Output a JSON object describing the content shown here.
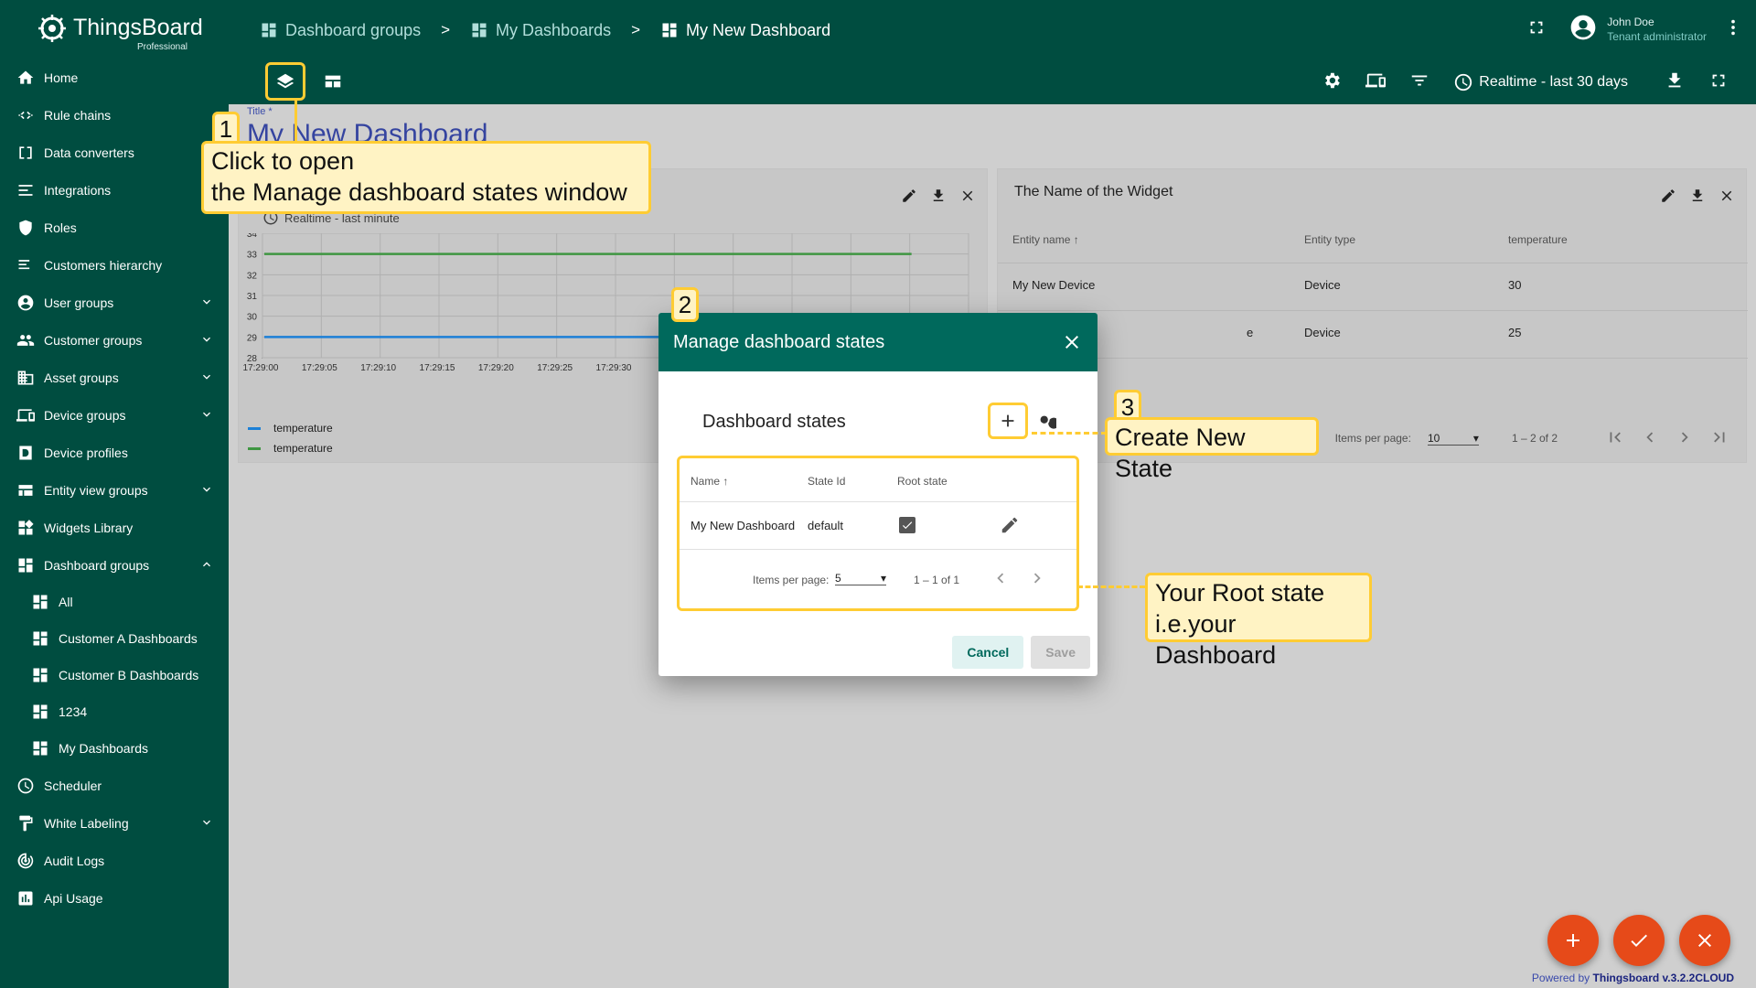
{
  "app": {
    "logo_text": "ThingsBoard",
    "logo_sub": "Professional"
  },
  "sidebar": {
    "items": [
      {
        "label": "Home",
        "icon": "home-icon",
        "chevron": ""
      },
      {
        "label": "Rule chains",
        "icon": "rule-chains-icon",
        "chevron": ""
      },
      {
        "label": "Data converters",
        "icon": "converter-icon",
        "chevron": ""
      },
      {
        "label": "Integrations",
        "icon": "integration-icon",
        "chevron": ""
      },
      {
        "label": "Roles",
        "icon": "shield-icon",
        "chevron": ""
      },
      {
        "label": "Customers hierarchy",
        "icon": "hierarchy-icon",
        "chevron": ""
      },
      {
        "label": "User groups",
        "icon": "account-icon",
        "chevron": "down"
      },
      {
        "label": "Customer groups",
        "icon": "group-icon",
        "chevron": "down"
      },
      {
        "label": "Asset groups",
        "icon": "domain-icon",
        "chevron": "down"
      },
      {
        "label": "Device groups",
        "icon": "devices-icon",
        "chevron": "down"
      },
      {
        "label": "Device profiles",
        "icon": "device-profile-icon",
        "chevron": ""
      },
      {
        "label": "Entity view groups",
        "icon": "view-quilt-icon",
        "chevron": "down"
      },
      {
        "label": "Widgets Library",
        "icon": "widgets-icon",
        "chevron": ""
      },
      {
        "label": "Dashboard groups",
        "icon": "dashboard-icon",
        "chevron": "up"
      }
    ],
    "sub_items": [
      {
        "label": "All"
      },
      {
        "label": "Customer A Dashboards"
      },
      {
        "label": "Customer B Dashboards"
      },
      {
        "label": "1234"
      },
      {
        "label": "My Dashboards"
      }
    ],
    "items_after": [
      {
        "label": "Scheduler",
        "icon": "schedule-icon",
        "chevron": ""
      },
      {
        "label": "White Labeling",
        "icon": "format-paint-icon",
        "chevron": "down"
      },
      {
        "label": "Audit Logs",
        "icon": "track-changes-icon",
        "chevron": ""
      },
      {
        "label": "Api Usage",
        "icon": "insert-chart-icon",
        "chevron": ""
      }
    ]
  },
  "breadcrumb": {
    "items": [
      "Dashboard groups",
      "My Dashboards",
      "My New Dashboard"
    ],
    "separator": ">"
  },
  "user": {
    "name": "John Doe",
    "role": "Tenant administrator"
  },
  "toolbar": {
    "timewindow": "Realtime - last 30 days"
  },
  "dashboard": {
    "title_label": "Title *",
    "title": "My New Dashboard"
  },
  "widget_chart": {
    "realtime": "Realtime - last minute",
    "legend": [
      {
        "name": "temperature",
        "color": "#1e88e5"
      },
      {
        "name": "temperature",
        "color": "#43a047"
      }
    ]
  },
  "chart_data": {
    "type": "line",
    "x": [
      "17:29:00",
      "17:29:05",
      "17:29:10",
      "17:29:15",
      "17:29:20",
      "17:29:25",
      "17:29:30",
      "17:29:35",
      "17:29:40",
      "17:29:45",
      "17:29:50",
      "17:29:55",
      "17:30:00"
    ],
    "x_tick_labels": [
      "17:29:00",
      "17:29:05",
      "17:29:10",
      "17:29:15",
      "17:29:20",
      "17:29:25",
      "17:29:30"
    ],
    "y_ticks": [
      28,
      29,
      30,
      31,
      32,
      33,
      34
    ],
    "ylim": [
      28,
      34
    ],
    "series": [
      {
        "name": "temperature",
        "color": "#1e88e5",
        "values": [
          29,
          29,
          29,
          29,
          29,
          29,
          29,
          29,
          29,
          29,
          29,
          29
        ]
      },
      {
        "name": "temperature",
        "color": "#43a047",
        "values": [
          33,
          33,
          33,
          33,
          33,
          33,
          33,
          33,
          33,
          33,
          33,
          33
        ]
      }
    ],
    "grid": true
  },
  "widget_table": {
    "title": "The Name of the Widget",
    "columns": [
      "Entity name",
      "Entity type",
      "temperature"
    ],
    "rows": [
      [
        "My New Device",
        "Device",
        "30"
      ],
      [
        "",
        "Device",
        "25"
      ]
    ],
    "row2_name_tail": "e",
    "items_per_page_label": "Items per page:",
    "items_per_page": "10",
    "range": "1 – 2 of 2"
  },
  "dialog": {
    "title": "Manage dashboard states",
    "subtitle": "Dashboard states",
    "columns": [
      "Name",
      "State Id",
      "Root state"
    ],
    "rows": [
      {
        "name": "My New Dashboard",
        "state_id": "default",
        "root": true
      }
    ],
    "items_per_page_label": "Items per page:",
    "items_per_page": "5",
    "range": "1 – 1 of 1",
    "cancel": "Cancel",
    "save": "Save"
  },
  "callouts": {
    "n1": "1",
    "c1_line1": "Click to open",
    "c1_line2": "the Manage dashboard states window",
    "n2": "2",
    "n3": "3",
    "c3": "Create New State",
    "c4_line1": "Your Root state",
    "c4_line2": "i.e.your Dashboard"
  },
  "footer": {
    "powered_prefix": "Powered by",
    "powered_brand": "Thingsboard v.3.2.2CLOUD"
  },
  "colors": {
    "primary": "#004d40",
    "dialog_header": "#00695c",
    "accent": "#e64a19",
    "callout_border": "#ffcc33"
  }
}
